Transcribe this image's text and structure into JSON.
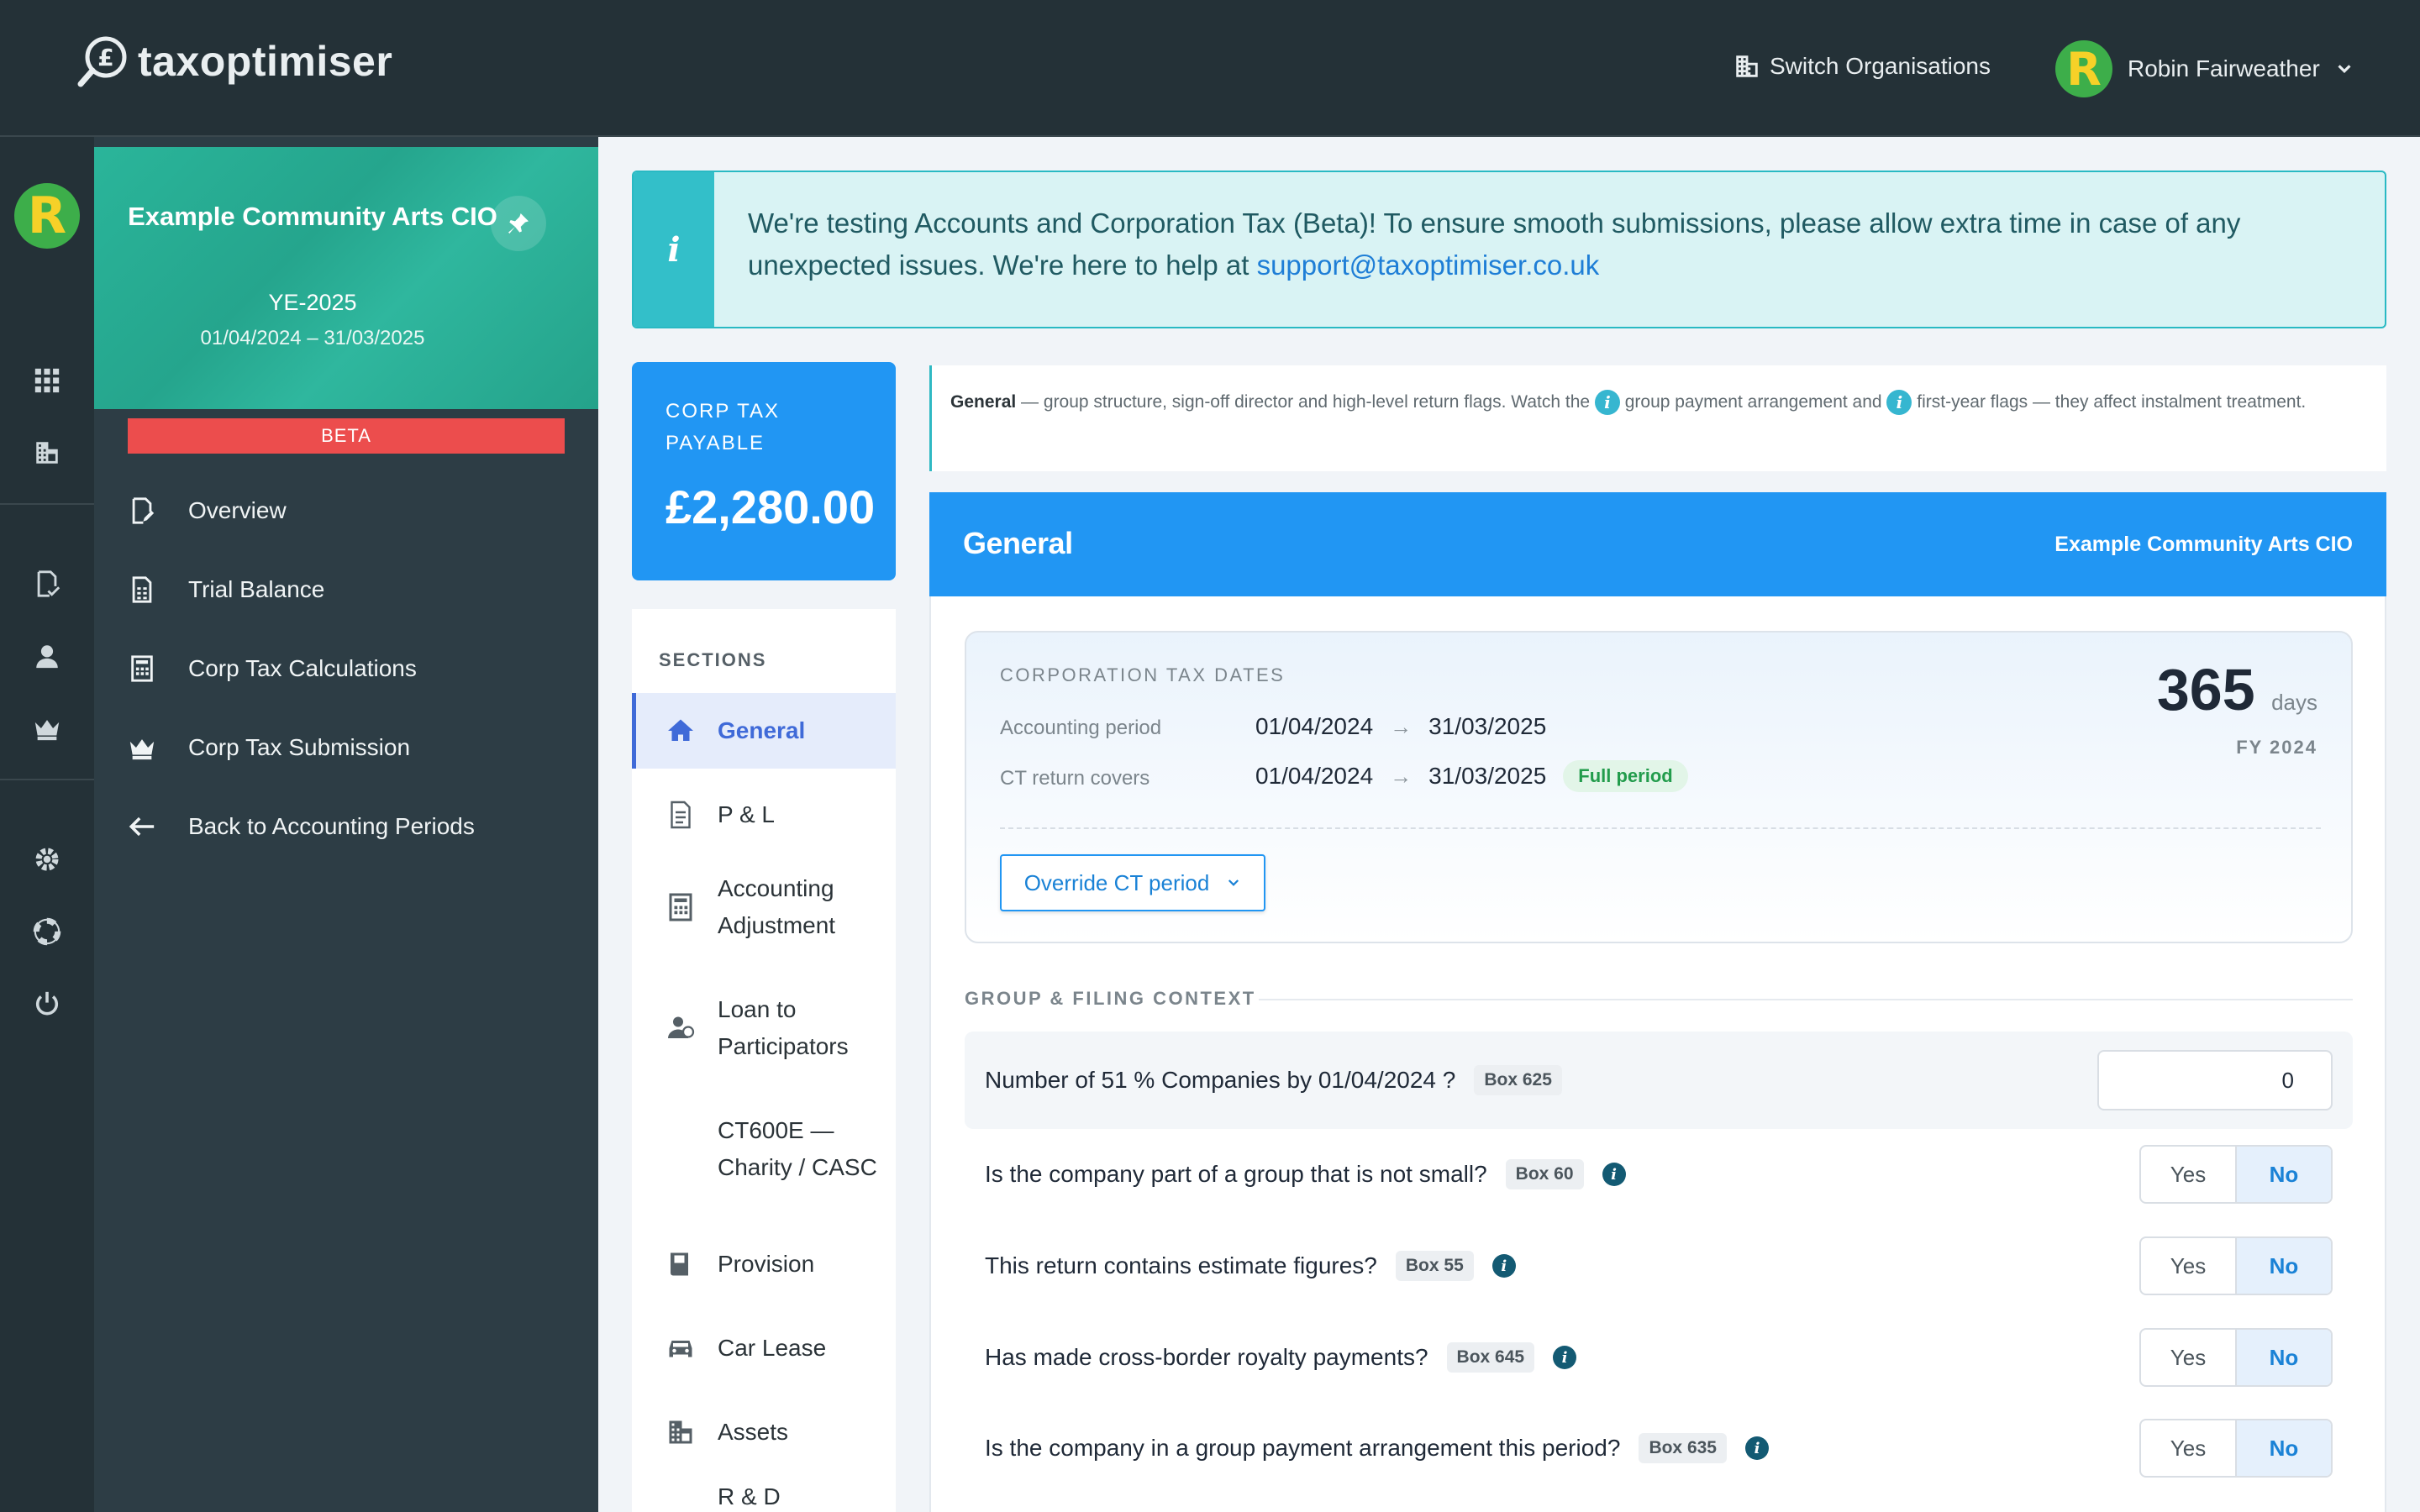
{
  "app": {
    "logo_text": "taxoptimiser",
    "switch_org_label": "Switch Organisations",
    "user_name": "Robin Fairweather",
    "avatar_letter": "R"
  },
  "org": {
    "name": "Example Community Arts CIO",
    "year_end": "YE-2025",
    "dates": "01/04/2024 – 31/03/2025",
    "beta": "BETA"
  },
  "nav": {
    "overview": "Overview",
    "trial_balance": "Trial Balance",
    "calcs": "Corp Tax Calculations",
    "submission": "Corp Tax Submission",
    "back": "Back to Accounting Periods"
  },
  "banner": {
    "text": "We're testing Accounts and Corporation Tax (Beta)! To ensure smooth submissions, please allow extra time in case of any unexpected issues. We're here to help at ",
    "link": "support@taxoptimiser.co.uk"
  },
  "tax_card": {
    "label": "CORP TAX PAYABLE",
    "value": "£2,280.00"
  },
  "sections": {
    "title": "SECTIONS",
    "items": [
      "General",
      "P & L",
      "Accounting Adjustment",
      "Loan to Participators",
      "CT600E — Charity / CASC",
      "Provision",
      "Car Lease",
      "Assets",
      "R & D"
    ]
  },
  "intro": {
    "bold": "General",
    "part1": " — group structure, sign-off director and high-level return flags. Watch the ",
    "part2": " group payment arrangement and ",
    "part3": " first-year flags — they affect instalment treatment."
  },
  "panel": {
    "title": "General",
    "org": "Example Community Arts CIO"
  },
  "ct_dates": {
    "label": "CORPORATION TAX DATES",
    "accounting_label": "Accounting period",
    "accounting_start": "01/04/2024",
    "accounting_end": "31/03/2025",
    "covers_label": "CT return covers",
    "covers_start": "01/04/2024",
    "covers_end": "31/03/2025",
    "badge": "Full period",
    "days": "365",
    "days_unit": "days",
    "fy": "FY 2024",
    "override": "Override CT period"
  },
  "group": {
    "label": "GROUP & FILING CONTEXT",
    "q1": {
      "text": "Number of 51 % Companies by 01/04/2024 ?",
      "box": "Box 625",
      "value": "0"
    },
    "q2": {
      "text": "Is the company part of a group that is not small?",
      "box": "Box 60"
    },
    "q3": {
      "text": "This return contains estimate figures?",
      "box": "Box 55"
    },
    "q4": {
      "text": "Has made cross-border royalty payments?",
      "box": "Box 645"
    },
    "q5": {
      "text": "Is the company in a group payment arrangement this period?",
      "box": "Box 635"
    },
    "yes": "Yes",
    "no": "No"
  }
}
